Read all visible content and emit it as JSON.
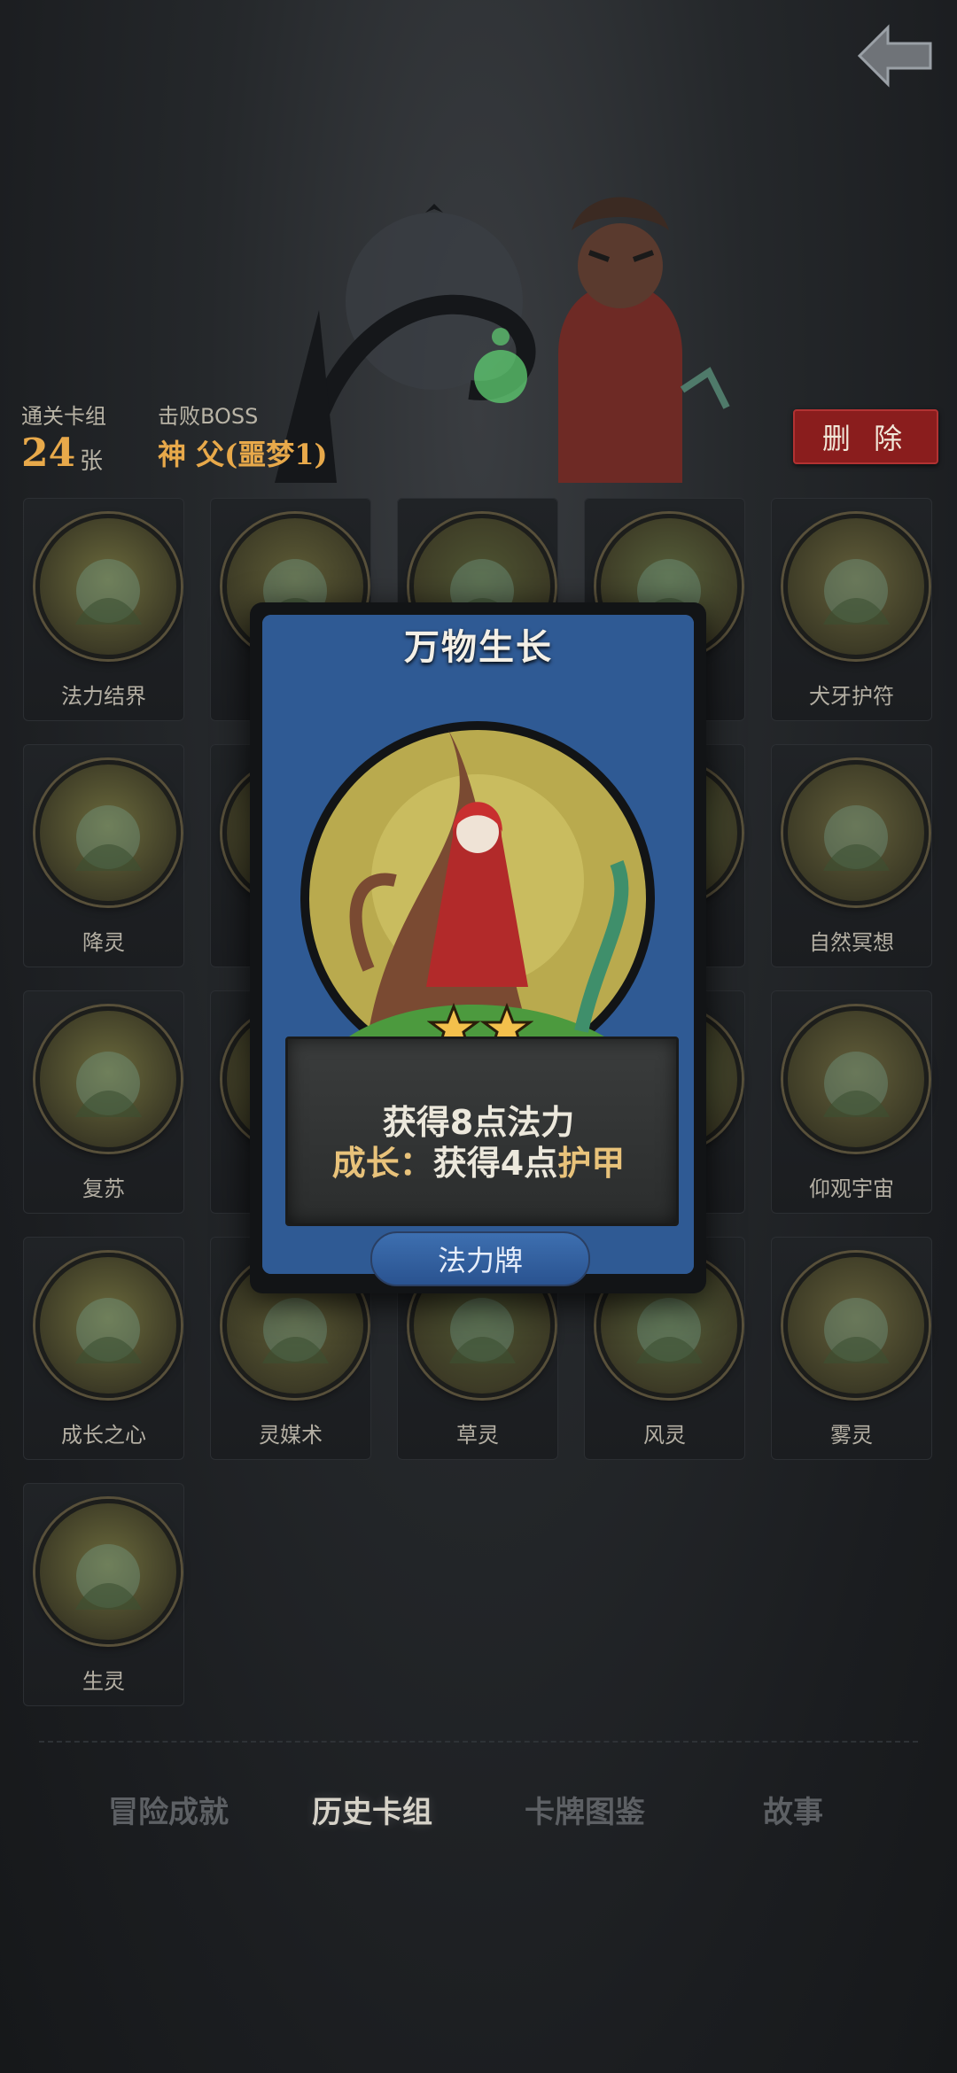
{
  "header": {
    "stats": {
      "clear_deck_label": "通关卡组",
      "clear_deck_count": "24",
      "clear_deck_unit": "张",
      "boss_label": "击败BOSS",
      "boss_name": "神 父(噩梦1)"
    },
    "delete_label": "删 除"
  },
  "cards": [
    {
      "name": "法力结界",
      "icon": "mana-barrier-icon",
      "visible_name": true
    },
    {
      "name": "",
      "icon": "warrior-icon",
      "visible_name": false
    },
    {
      "name": "",
      "icon": "beast-spirit-icon",
      "visible_name": false
    },
    {
      "name": "",
      "icon": "acorn-icon",
      "visible_name": false
    },
    {
      "name": "犬牙护符",
      "icon": "fang-amulet-icon",
      "visible_name": true
    },
    {
      "name": "降灵",
      "icon": "summon-spirit-icon",
      "visible_name": true
    },
    {
      "name": "",
      "icon": "hidden-icon",
      "visible_name": false
    },
    {
      "name": "",
      "icon": "hidden-icon",
      "visible_name": false
    },
    {
      "name": "",
      "icon": "hidden-icon",
      "visible_name": false
    },
    {
      "name": "自然冥想",
      "icon": "meditation-icon",
      "visible_name": true
    },
    {
      "name": "复苏",
      "icon": "revive-icon",
      "visible_name": true
    },
    {
      "name": "",
      "icon": "hidden-icon",
      "visible_name": false
    },
    {
      "name": "",
      "icon": "hidden-icon",
      "visible_name": false
    },
    {
      "name": "",
      "icon": "hidden-icon",
      "visible_name": false
    },
    {
      "name": "仰观宇宙",
      "icon": "cosmos-icon",
      "visible_name": true
    },
    {
      "name": "成长之心",
      "icon": "growth-heart-icon",
      "visible_name": true
    },
    {
      "name": "灵媒术",
      "icon": "skull-icon",
      "visible_name": true
    },
    {
      "name": "草灵",
      "icon": "grass-spirit-icon",
      "visible_name": true
    },
    {
      "name": "风灵",
      "icon": "wind-spirit-icon",
      "visible_name": true
    },
    {
      "name": "雾灵",
      "icon": "mist-spirit-icon",
      "visible_name": true
    },
    {
      "name": "生灵",
      "icon": "butterfly-icon",
      "visible_name": true
    }
  ],
  "modal": {
    "title": "万物生长",
    "stars": 2,
    "description_line1": "获得8点法力",
    "description_line2_prefix": "成长：",
    "description_line2_rest": "获得4点",
    "description_line2_keyword": "护甲",
    "card_type": "法力牌"
  },
  "nav": {
    "tabs": [
      {
        "label": "冒险成就",
        "active": false
      },
      {
        "label": "历史卡组",
        "active": true
      },
      {
        "label": "卡牌图鉴",
        "active": false
      },
      {
        "label": "故事",
        "active": false
      }
    ]
  },
  "colors": {
    "accent_gold": "#e8a94a",
    "delete_red": "#8a1d1d",
    "card_blue": "#3b6dab"
  }
}
